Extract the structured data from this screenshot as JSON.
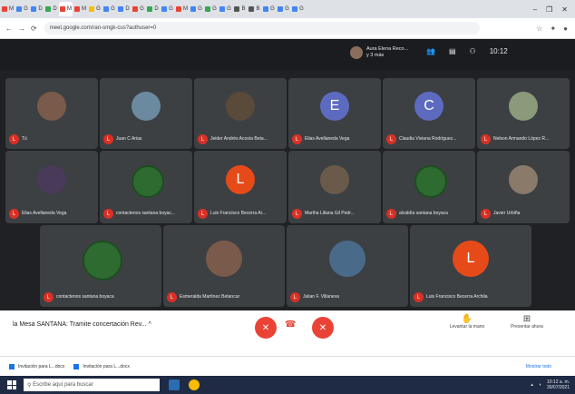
{
  "browser": {
    "tabs": [
      {
        "label": "M",
        "color": "#ea4335"
      },
      {
        "label": "G",
        "color": "#4285f4"
      },
      {
        "label": "D",
        "color": "#4285f4"
      },
      {
        "label": "D",
        "color": "#34a853"
      },
      {
        "label": "M",
        "color": "#ea4335"
      },
      {
        "label": "M",
        "color": "#ea4335"
      },
      {
        "label": "G",
        "color": "#fbbc04"
      },
      {
        "label": "G",
        "color": "#4285f4"
      },
      {
        "label": "D",
        "color": "#4285f4"
      },
      {
        "label": "G",
        "color": "#ea4335"
      },
      {
        "label": "D",
        "color": "#34a853"
      },
      {
        "label": "G",
        "color": "#4285f4"
      },
      {
        "label": "M",
        "color": "#ea4335"
      },
      {
        "label": "G",
        "color": "#4285f4"
      },
      {
        "label": "G",
        "color": "#34a853"
      },
      {
        "label": "G",
        "color": "#4285f4"
      },
      {
        "label": "B",
        "color": "#555555"
      },
      {
        "label": "B",
        "color": "#555555"
      },
      {
        "label": "G",
        "color": "#4285f4"
      },
      {
        "label": "G",
        "color": "#4285f4"
      },
      {
        "label": "G",
        "color": "#4285f4"
      }
    ],
    "url": "meet.google.com/ran-smgk-cus?authuser=0",
    "minimize": "–",
    "maximize": "❐",
    "close": "✕"
  },
  "meet": {
    "presenter_name": "Aura Elena Reco...",
    "presenter_sub": "y 3 más",
    "time": "10:12",
    "participants": [
      {
        "name": "Tú",
        "kind": "photo",
        "color": "#7a5a4a"
      },
      {
        "name": "Juan C Arias",
        "kind": "photo",
        "color": "#6b8aa0"
      },
      {
        "name": "Jeider Andrés Acosta Beta...",
        "kind": "photo",
        "color": "#5a4a3a"
      },
      {
        "name": "Elias Avellaneda Vega",
        "kind": "letter",
        "letter": "E",
        "color": "#5c6bc0"
      },
      {
        "name": "Claudia Viviana Rodríguez...",
        "kind": "letter",
        "letter": "C",
        "color": "#5c6bc0"
      },
      {
        "name": "Nelson Armando López R...",
        "kind": "photo",
        "color": "#8a9a7a"
      },
      {
        "name": "Elias Avellaneda Vega",
        "kind": "photo",
        "color": "#4a3a5a"
      },
      {
        "name": "contactenos santana boyac...",
        "kind": "emblem",
        "color": "#2e6b30"
      },
      {
        "name": "Luis Francisco Becerra Ar...",
        "kind": "letter",
        "letter": "L",
        "color": "#e64a19"
      },
      {
        "name": "Martha Liliana Gil Pedr...",
        "kind": "photo",
        "color": "#6a5a4a"
      },
      {
        "name": "alcaldía santana boyaca",
        "kind": "emblem",
        "color": "#2e6b30"
      },
      {
        "name": "Javier Urbiña",
        "kind": "photo",
        "color": "#8a7a6a"
      },
      {
        "name": "contactenos santana boyaca",
        "kind": "emblem",
        "color": "#2e6b30"
      },
      {
        "name": "Esmeralda Martínez Betancur",
        "kind": "photo",
        "color": "#7a5a4a"
      },
      {
        "name": "Julian F. Villaneva",
        "kind": "photo",
        "color": "#4a6a8a"
      },
      {
        "name": "Luis Francisco Becerra Archila",
        "kind": "letter",
        "letter": "L",
        "color": "#e64a19"
      }
    ],
    "rec_letter": "L"
  },
  "controls": {
    "meeting_title": "la Mesa SANTANA: Tramite concertación Rev...",
    "caret": "^",
    "mic_icon": "✕",
    "hangup_icon": "☎",
    "cam_icon": "✕",
    "raise_hand": "Levantar la mano",
    "present": "Presentar ahora",
    "hand_glyph": "✋",
    "present_glyph": "⊞"
  },
  "downloads": {
    "items": [
      "Invitación para L...docx",
      "Invitación para L...docx"
    ],
    "show_all": "Mostrar todo"
  },
  "taskbar": {
    "search_placeholder": "Escribe aquí para buscar",
    "clock": "10:12 a. m.",
    "date": "30/07/2021"
  }
}
